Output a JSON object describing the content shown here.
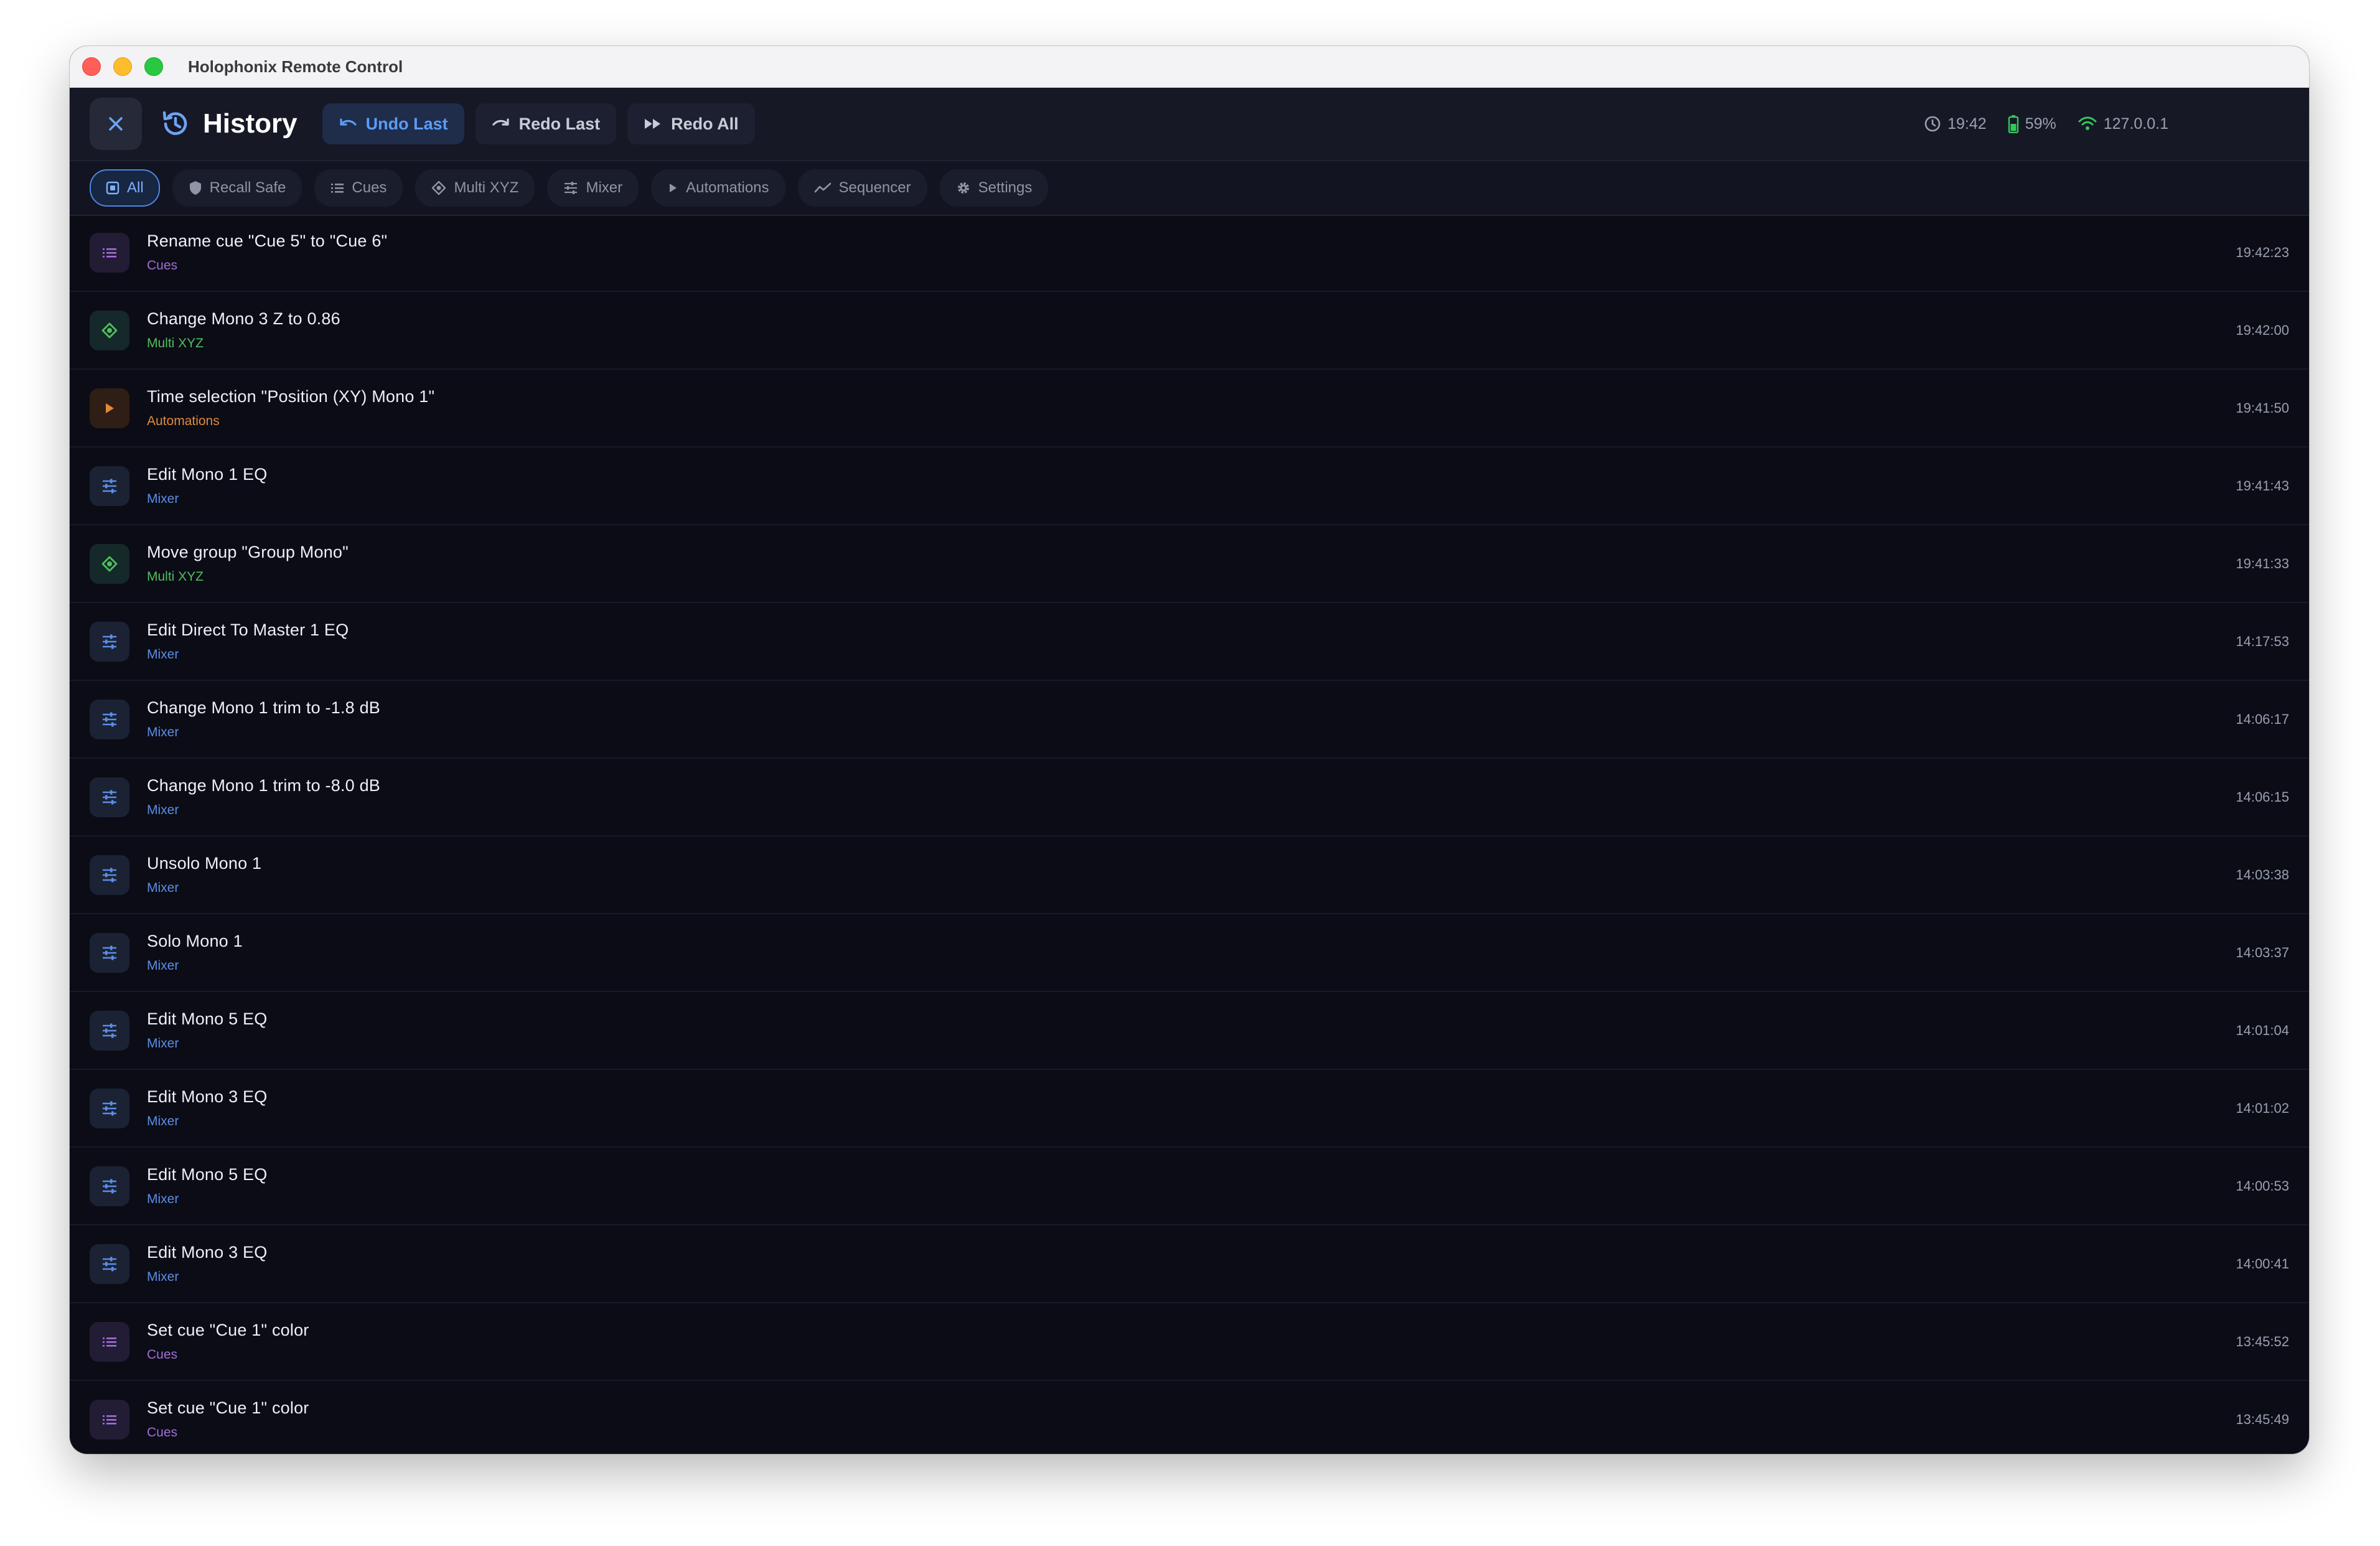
{
  "window": {
    "title": "Holophonix Remote Control"
  },
  "toolbar": {
    "title": "History",
    "undo_last": "Undo Last",
    "redo_last": "Redo Last",
    "redo_all": "Redo All"
  },
  "status": {
    "time": "19:42",
    "battery": "59%",
    "ip": "127.0.0.1"
  },
  "filters": [
    {
      "label": "All",
      "icon": "all-icon",
      "active": true
    },
    {
      "label": "Recall Safe",
      "icon": "shield-icon"
    },
    {
      "label": "Cues",
      "icon": "list-icon"
    },
    {
      "label": "Multi XYZ",
      "icon": "target-icon"
    },
    {
      "label": "Mixer",
      "icon": "sliders-icon"
    },
    {
      "label": "Automations",
      "icon": "play-icon"
    },
    {
      "label": "Sequencer",
      "icon": "trend-icon"
    },
    {
      "label": "Settings",
      "icon": "gear-icon"
    }
  ],
  "colors": {
    "accent": "#5b9cf6",
    "cues": "#a56cd8",
    "multi_xyz": "#4fbf5c",
    "automations": "#e08a3a",
    "mixer": "#5b8ee6"
  },
  "history": [
    {
      "title": "Rename cue \"Cue 5\" to \"Cue 6\"",
      "category": "Cues",
      "time": "19:42:23"
    },
    {
      "title": "Change Mono 3 Z to 0.86",
      "category": "Multi XYZ",
      "time": "19:42:00"
    },
    {
      "title": "Time selection \"Position (XY) Mono 1\"",
      "category": "Automations",
      "time": "19:41:50"
    },
    {
      "title": "Edit Mono 1 EQ",
      "category": "Mixer",
      "time": "19:41:43"
    },
    {
      "title": "Move group \"Group Mono\"",
      "category": "Multi XYZ",
      "time": "19:41:33"
    },
    {
      "title": "Edit Direct To Master 1 EQ",
      "category": "Mixer",
      "time": "14:17:53"
    },
    {
      "title": "Change Mono 1 trim to -1.8 dB",
      "category": "Mixer",
      "time": "14:06:17"
    },
    {
      "title": "Change Mono 1 trim to -8.0 dB",
      "category": "Mixer",
      "time": "14:06:15"
    },
    {
      "title": "Unsolo Mono 1",
      "category": "Mixer",
      "time": "14:03:38"
    },
    {
      "title": "Solo Mono 1",
      "category": "Mixer",
      "time": "14:03:37"
    },
    {
      "title": "Edit Mono 5 EQ",
      "category": "Mixer",
      "time": "14:01:04"
    },
    {
      "title": "Edit Mono 3 EQ",
      "category": "Mixer",
      "time": "14:01:02"
    },
    {
      "title": "Edit Mono 5 EQ",
      "category": "Mixer",
      "time": "14:00:53"
    },
    {
      "title": "Edit Mono 3 EQ",
      "category": "Mixer",
      "time": "14:00:41"
    },
    {
      "title": "Set cue \"Cue 1\" color",
      "category": "Cues",
      "time": "13:45:52"
    },
    {
      "title": "Set cue \"Cue 1\" color",
      "category": "Cues",
      "time": "13:45:49"
    }
  ]
}
